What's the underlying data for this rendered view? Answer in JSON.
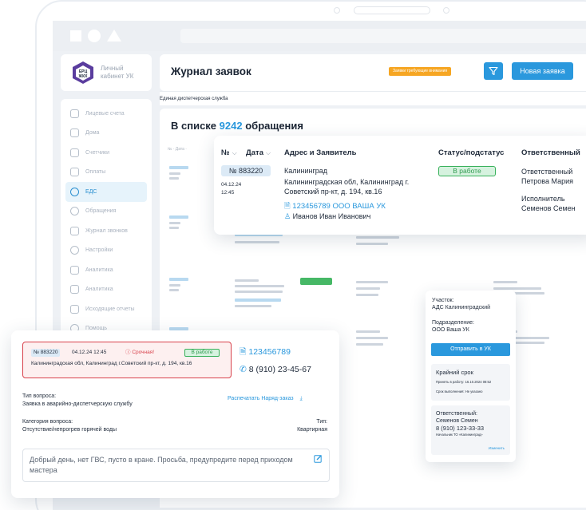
{
  "app": {
    "logo_line1": "ЕРЦ",
    "logo_line2": "ЖКХ",
    "brand_title_line1": "Личный",
    "brand_title_line2": "кабинет УК"
  },
  "sidebar": {
    "items": [
      {
        "label": "Лицевые счета",
        "icon": "accounts-icon"
      },
      {
        "label": "Дома",
        "icon": "home-icon"
      },
      {
        "label": "Счетчики",
        "icon": "meters-icon"
      },
      {
        "label": "Оплаты",
        "icon": "card-icon"
      },
      {
        "label": "ЕДС",
        "icon": "chat-icon",
        "active": true
      },
      {
        "label": "Обращения",
        "icon": "message-icon"
      },
      {
        "label": "Журнал звонков",
        "icon": "phone-icon"
      },
      {
        "label": "Настройки",
        "icon": "gear-icon"
      },
      {
        "label": "Аналитика",
        "icon": "analytics-icon"
      },
      {
        "label": "Аналитика",
        "icon": "report-icon"
      },
      {
        "label": "Исходящие отчеты",
        "icon": "outbox-icon"
      },
      {
        "label": "Помощь",
        "icon": "help-icon"
      }
    ]
  },
  "header": {
    "title": "Журнал заявок",
    "attention_badge": "Заявки требующие внимания",
    "new_request_label": "Новая заявка"
  },
  "service": {
    "name": "Единая диспетчерская служба"
  },
  "list": {
    "title_prefix": "В списке",
    "count": "9242",
    "title_suffix": "обращения",
    "ghost_col": "№ · Дата ·"
  },
  "table": {
    "columns": {
      "num": "№",
      "date": "Дата",
      "address": "Адрес и Заявитель",
      "status": "Статус/подстатус",
      "responsible": "Ответственный"
    },
    "row": {
      "number": "№ 883220",
      "date": "04.12.24",
      "time": "12:45",
      "city": "Калининград",
      "address": "Калининградская обл, Калининград г. Советский пр-кт, д. 194, кв.16",
      "account": "123456789 ООО ВАША УК",
      "applicant": "Иванов Иван Иванович",
      "status": "В работе",
      "responsible_label": "Ответственный",
      "responsible_name": "Петрова Мария",
      "executor_label": "Исполнитель",
      "executor_name": "Семенов Семен"
    }
  },
  "panel": {
    "area_label": "Участок:",
    "area_value": "АДС Калининградский",
    "division_label": "Подразделение:",
    "division_value": "ООО Ваша УК",
    "send_label": "Отправить в УК",
    "deadline_title": "Крайний срок",
    "accept_text": "Принять в работу: 16.10.2024 08:52",
    "done_text": "Срок выполнения: Не указано",
    "resp_label": "Ответственный:",
    "resp_name": "Семенов Семен",
    "resp_phone": "8 (910) 123-33-33",
    "resp_role": "Начальник ТО «Калининград»",
    "change_link": "Изменить"
  },
  "detail": {
    "number": "№ 883220",
    "datetime": "04.12.24   12:45",
    "urgent": "Срочная!",
    "status": "В работе",
    "address": "Калининградская обл, Калининград г.Советский пр-кт, д. 194, кв.16",
    "account": "123456789",
    "phone": "8 (910) 23-45-67",
    "question_type_label": "Тип вопроса:",
    "question_type_value": "Заявка в аварийно-диспетчерскую службу",
    "print_label": "Распечатать Наряд-заказ",
    "category_label": "Категория вопроса:",
    "category_value": "Отсутствие/непрогрев горячей воды",
    "kind_label": "Тип:",
    "kind_value": "Квартирная",
    "comment": "Добрый день, нет ГВС, пусто в кране. Просьба, предупредите перед приходом мастера"
  },
  "colors": {
    "accent": "#2a98dd",
    "urgent": "#d8414b",
    "success": "#38b15a",
    "warning": "#f6a623"
  }
}
